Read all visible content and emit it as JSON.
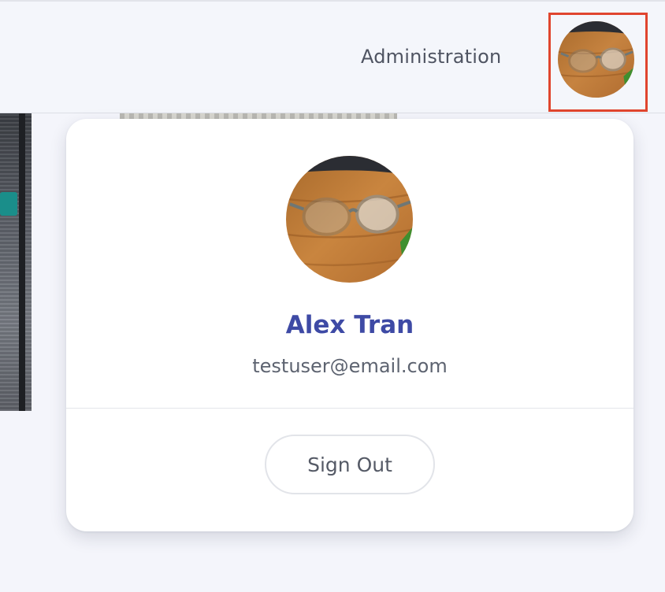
{
  "header": {
    "nav_admin_label": "Administration"
  },
  "profile_menu": {
    "user_name": "Alex Tran",
    "user_email": "testuser@email.com",
    "sign_out_label": "Sign Out"
  },
  "colors": {
    "name_accent": "#3e4aa5",
    "highlight_outline": "#e0452e"
  }
}
